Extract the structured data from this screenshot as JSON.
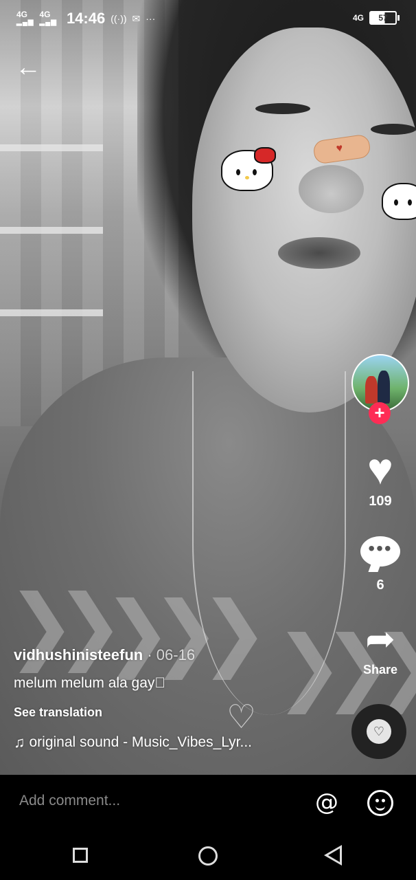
{
  "status_bar": {
    "network_1": "4G",
    "network_2": "4G",
    "time": "14:46",
    "network_right": "4G",
    "battery": "57"
  },
  "video": {
    "description_icons": [
      "back-arrow-icon"
    ]
  },
  "post": {
    "username": "vidhushinisteefun",
    "date": " · 06-16",
    "description": "melum melum ala gay\u0000",
    "see_translation": "See translation",
    "sound": "original sound - Music_Vibes_Lyr..."
  },
  "actions": {
    "likes": "109",
    "comments": "6",
    "share_label": "Share"
  },
  "comment_bar": {
    "placeholder": "Add comment..."
  },
  "colors": {
    "accent": "#fe2c55",
    "background": "#000000",
    "text": "#ffffff",
    "placeholder": "#8a8a8a"
  }
}
